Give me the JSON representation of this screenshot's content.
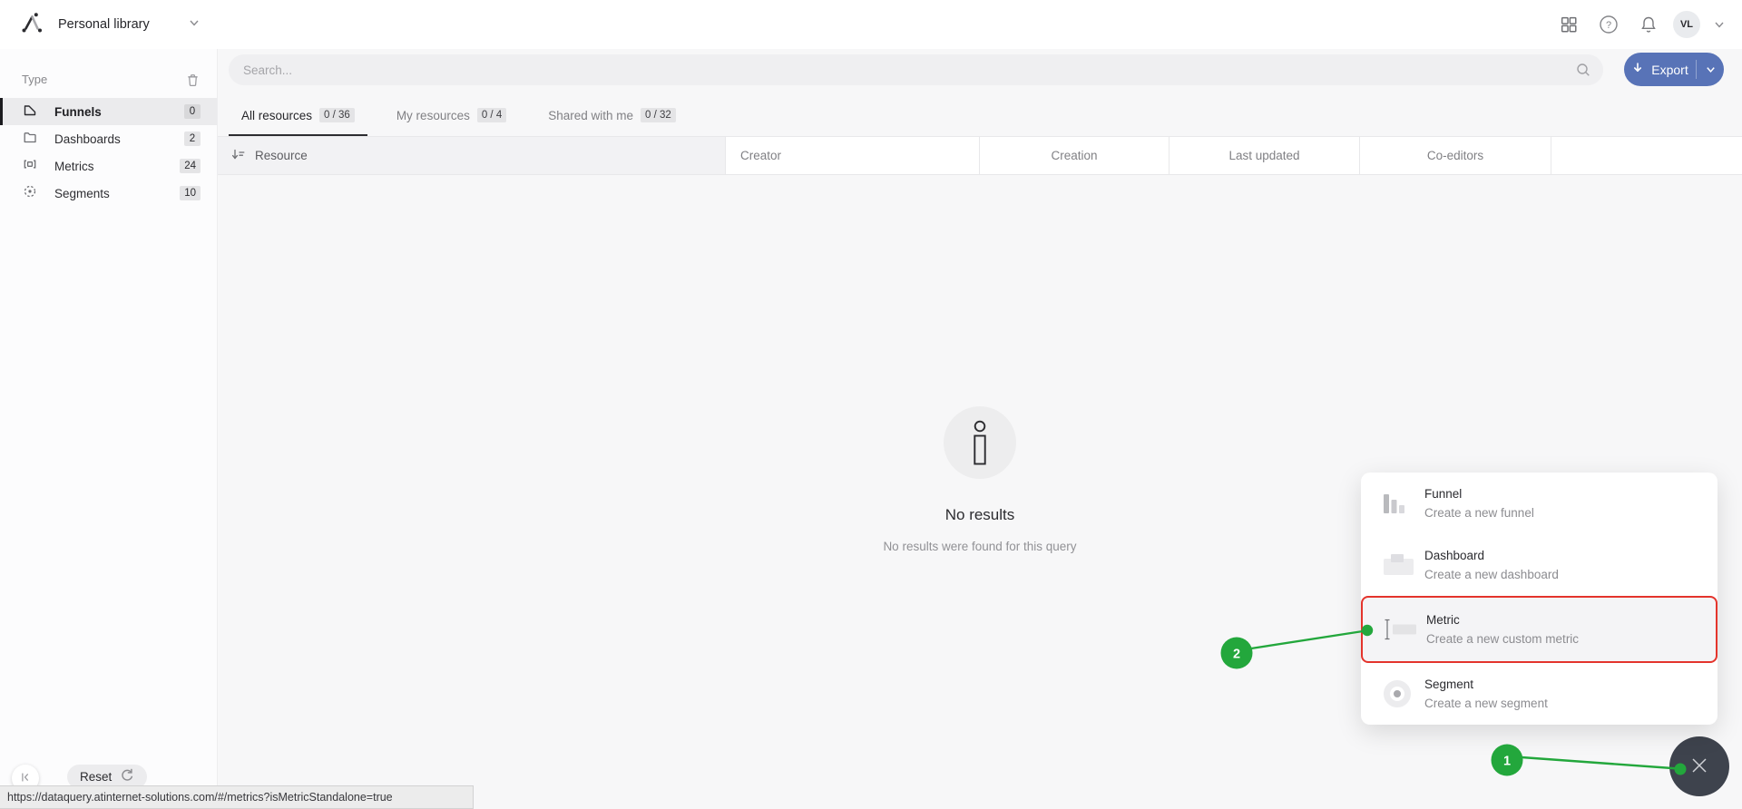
{
  "app": {
    "name": "Personal library"
  },
  "topbar": {
    "avatar_initials": "VL"
  },
  "sidebar": {
    "section_label": "Type",
    "items": [
      {
        "label": "Funnels",
        "count": "0",
        "active": true
      },
      {
        "label": "Dashboards",
        "count": "2",
        "active": false
      },
      {
        "label": "Metrics",
        "count": "24",
        "active": false
      },
      {
        "label": "Segments",
        "count": "10",
        "active": false
      }
    ]
  },
  "search": {
    "placeholder": "Search..."
  },
  "toolbar": {
    "export_label": "Export"
  },
  "tabs": [
    {
      "label": "All resources",
      "count": "0 / 36",
      "active": true
    },
    {
      "label": "My resources",
      "count": "0 / 4",
      "active": false
    },
    {
      "label": "Shared with me",
      "count": "0 / 32",
      "active": false
    }
  ],
  "table": {
    "columns": [
      "Resource",
      "Creator",
      "Creation",
      "Last updated",
      "Co-editors"
    ]
  },
  "empty_state": {
    "title": "No results",
    "subtitle": "No results were found for this query"
  },
  "create_menu": {
    "items": [
      {
        "title": "Funnel",
        "subtitle": "Create a new funnel",
        "highlighted": false
      },
      {
        "title": "Dashboard",
        "subtitle": "Create a new dashboard",
        "highlighted": false
      },
      {
        "title": "Metric",
        "subtitle": "Create a new custom metric",
        "highlighted": true
      },
      {
        "title": "Segment",
        "subtitle": "Create a new segment",
        "highlighted": false
      }
    ]
  },
  "annotations": {
    "step_1": "1",
    "step_2": "2"
  },
  "footer": {
    "reset_label": "Reset",
    "status_url": "https://dataquery.atinternet-solutions.com/#/metrics?isMetricStandalone=true"
  },
  "colors": {
    "accent_green": "#23a73c",
    "highlight_red": "#e4342c",
    "export_blue": "#5873b7",
    "fab_dark": "#3e434d"
  }
}
